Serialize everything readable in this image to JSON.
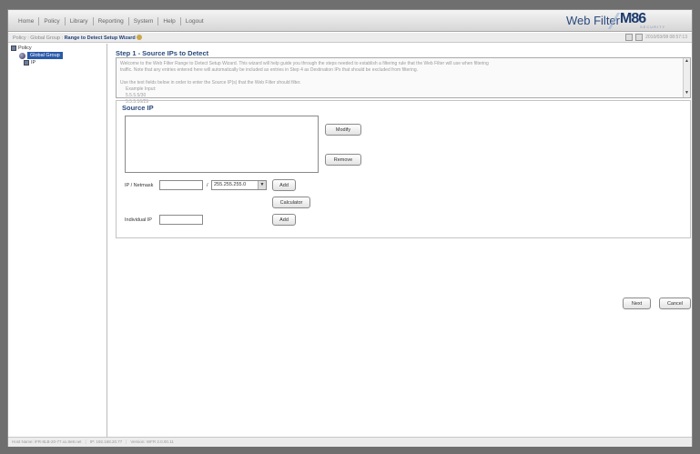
{
  "nav": {
    "items": [
      "Home",
      "Policy",
      "Library",
      "Reporting",
      "System",
      "Help",
      "Logout"
    ]
  },
  "brand": {
    "product": "Web Filter",
    "logo_text": "M86",
    "logo_sub": "SECURITY"
  },
  "breadcrumb": {
    "path": "Policy : Global Group : ",
    "current": "Range to Detect Setup Wizard",
    "datetime": "2010/03/08 08:57:13"
  },
  "tree": {
    "root": "Policy",
    "selected": "Global Group",
    "child": "IP"
  },
  "wizard": {
    "step_title": "Step 1 - Source IPs to Detect",
    "intro_line1": "Welcome to the Web Filter Range to Detect Setup Wizard. This wizard will help guide you through the steps needed to establish a filtering rule that the Web Filter will use when filtering",
    "intro_line2": "traffic. Note that any entries entered here will automatically be included as entries in Step 4 as Destination IPs that should be excluded from filtering.",
    "intro_line3": "Use the text fields below in order to enter the Source IP(s) that the Web Filter should filter.",
    "example_label": "Example Input:",
    "example_1": "5.5.5.5/30",
    "example_2": "5.5.5.16/29",
    "example_3": "5.5.5.1"
  },
  "source_ip": {
    "title": "Source IP",
    "modify_label": "Modify",
    "remove_label": "Remove",
    "ip_netmask_label": "IP / Netmask",
    "ip_value": "",
    "slash": "/",
    "netmask_value": "255.255.255.0",
    "add_label": "Add",
    "calculator_label": "Calculator",
    "individual_ip_label": "Individual IP",
    "individual_ip_value": "",
    "add2_label": "Add"
  },
  "footer_buttons": {
    "next_label": "Next",
    "cancel_label": "Cancel"
  },
  "status": {
    "host": "Host Name: iFR-8LB-20-77.xx.8e8.net",
    "ip": "IP: 192.168.20.77",
    "version": "Version: WFR 2.0.00.11"
  },
  "colors": {
    "accent": "#2a4a7d",
    "selection": "#2a5aa8"
  }
}
